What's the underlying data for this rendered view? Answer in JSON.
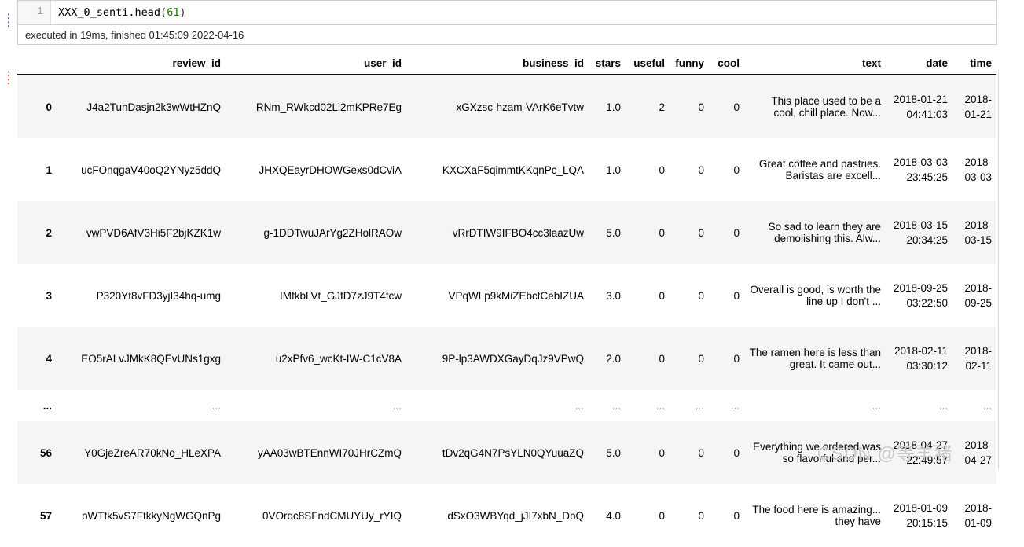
{
  "notebook": {
    "in_prompt": ":",
    "out_prompt": ":",
    "line_number": "1",
    "code_prefix": "XXX_0_senti.head",
    "code_open_paren": "(",
    "code_arg": "61",
    "code_close_paren": ")",
    "execution_status": "executed in 19ms, finished 01:45:09 2022-04-16"
  },
  "watermark": "CSDN @等羊猪",
  "table": {
    "columns": [
      "review_id",
      "user_id",
      "business_id",
      "stars",
      "useful",
      "funny",
      "cool",
      "text",
      "date",
      "time"
    ],
    "rows": [
      {
        "index": "0",
        "review_id": "J4a2TuhDasjn2k3wWtHZnQ",
        "user_id": "RNm_RWkcd02Li2mKPRe7Eg",
        "business_id": "xGXzsc-hzam-VArK6eTvtw",
        "stars": "1.0",
        "useful": "2",
        "funny": "0",
        "cool": "0",
        "text": "This place used to be a cool, chill place. Now...",
        "date": "2018-01-21 04:41:03",
        "time": "2018-01-21"
      },
      {
        "index": "1",
        "review_id": "ucFOnqgaV40oQ2YNyz5ddQ",
        "user_id": "JHXQEayrDHOWGexs0dCviA",
        "business_id": "KXCXaF5qimmtKKqnPc_LQA",
        "stars": "1.0",
        "useful": "0",
        "funny": "0",
        "cool": "0",
        "text": "Great coffee and pastries. Baristas are excell...",
        "date": "2018-03-03 23:45:25",
        "time": "2018-03-03"
      },
      {
        "index": "2",
        "review_id": "vwPVD6AfV3Hi5F2bjKZK1w",
        "user_id": "g-1DDTwuJArYg2ZHolRAOw",
        "business_id": "vRrDTIW9IFBO4cc3laazUw",
        "stars": "5.0",
        "useful": "0",
        "funny": "0",
        "cool": "0",
        "text": "So sad to learn they are demolishing this. Alw...",
        "date": "2018-03-15 20:34:25",
        "time": "2018-03-15"
      },
      {
        "index": "3",
        "review_id": "P320Yt8vFD3yjI34hq-umg",
        "user_id": "IMfkbLVt_GJfD7zJ9T4fcw",
        "business_id": "VPqWLp9kMiZEbctCebIZUA",
        "stars": "3.0",
        "useful": "0",
        "funny": "0",
        "cool": "0",
        "text": "Overall is good, is worth the line up I don't ...",
        "date": "2018-09-25 03:22:50",
        "time": "2018-09-25"
      },
      {
        "index": "4",
        "review_id": "EO5rALvJMkK8QEvUNs1gxg",
        "user_id": "u2xPfv6_wcKt-IW-C1cV8A",
        "business_id": "9P-lp3AWDXGayDqJz9VPwQ",
        "stars": "2.0",
        "useful": "0",
        "funny": "0",
        "cool": "0",
        "text": "The ramen here is less than great. It came out...",
        "date": "2018-02-11 03:30:12",
        "time": "2018-02-11"
      },
      {
        "index": "...",
        "review_id": "...",
        "user_id": "...",
        "business_id": "...",
        "stars": "...",
        "useful": "...",
        "funny": "...",
        "cool": "...",
        "text": "...",
        "date": "...",
        "time": "..."
      },
      {
        "index": "56",
        "review_id": "Y0GjeZreAR70kNo_HLeXPA",
        "user_id": "yAA03wBTEnnWI70JHrCZmQ",
        "business_id": "tDv2qG4N7PsYLN0QYuuaZQ",
        "stars": "5.0",
        "useful": "0",
        "funny": "0",
        "cool": "0",
        "text": "Everything we ordered was so flavorful and per...",
        "date": "2018-04-27 22:49:57",
        "time": "2018-04-27"
      },
      {
        "index": "57",
        "review_id": "pWTfk5vS7FtkkyNgWGQnPg",
        "user_id": "0VOrqc8SFndCMUYUy_rYIQ",
        "business_id": "dSxO3WBYqd_jJI7xbN_DbQ",
        "stars": "4.0",
        "useful": "0",
        "funny": "0",
        "cool": "0",
        "text": "The food here is amazing... they have",
        "date": "2018-01-09 20:15:15",
        "time": "2018-01-09"
      }
    ]
  }
}
